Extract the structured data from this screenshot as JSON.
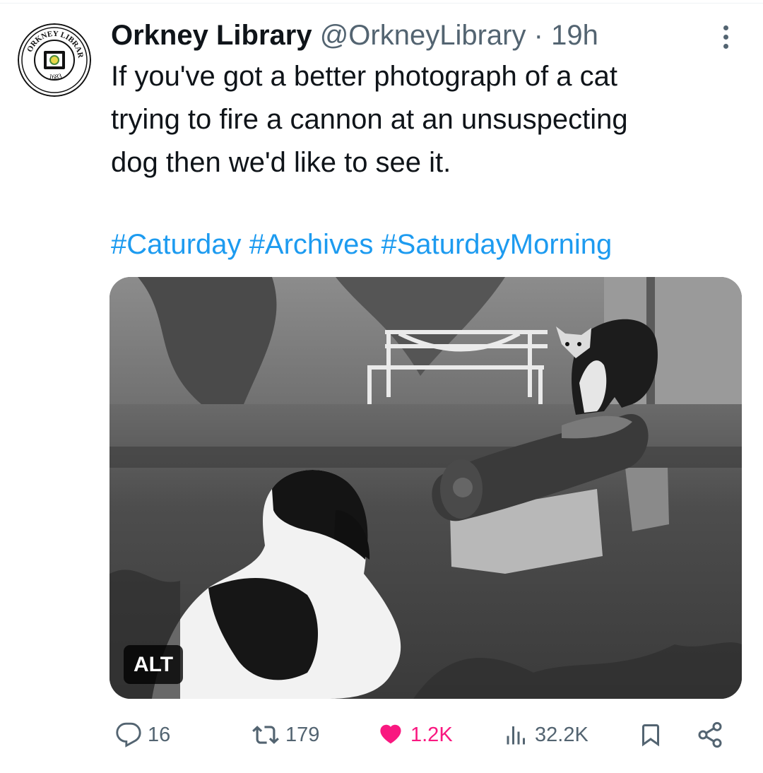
{
  "tweet": {
    "author": {
      "display_name": "Orkney Library",
      "handle": "@OrkneyLibrary",
      "avatar_icon": "orkney-library-seal-icon",
      "avatar_text": {
        "top": "LIBRARY",
        "left": "ORKNEY",
        "right": "& ARCHIVE",
        "year": "1683"
      }
    },
    "separator": "·",
    "time": "19h",
    "more_icon": "more-vertical-icon",
    "text_lines": [
      "If you've got a better photograph of a cat",
      "trying to fire a cannon at an unsuspecting",
      "dog then we'd like to see it."
    ],
    "hashtags": [
      "#Caturday",
      "#Archives",
      "#SaturdayMorning"
    ],
    "media": {
      "alt_label": "ALT"
    },
    "actions": {
      "reply": {
        "icon": "reply-icon",
        "count": "16"
      },
      "retweet": {
        "icon": "retweet-icon",
        "count": "179"
      },
      "like": {
        "icon": "heart-icon",
        "count": "1.2K",
        "liked": true
      },
      "views": {
        "icon": "views-chart-icon",
        "count": "32.2K"
      },
      "bookmark": {
        "icon": "bookmark-icon"
      },
      "share": {
        "icon": "share-icon"
      }
    }
  },
  "colors": {
    "text": "#0f1419",
    "secondary": "#536471",
    "hashtag": "#1d9bf0",
    "like": "#f91880"
  }
}
